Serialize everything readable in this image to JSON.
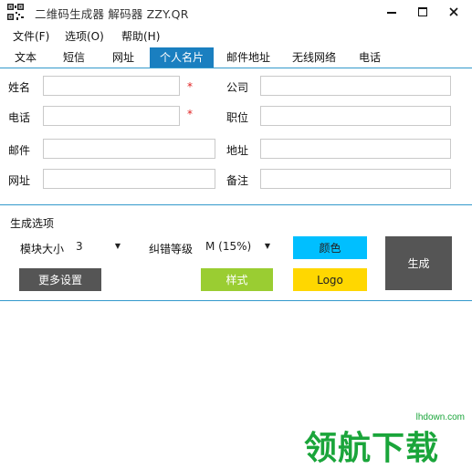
{
  "window": {
    "title": "二维码生成器 解码器 ZZY.QR",
    "minimize_icon": "minimize-icon",
    "maximize_icon": "maximize-icon",
    "close_icon": "close-icon"
  },
  "menu": [
    {
      "label": "文件(F)"
    },
    {
      "label": "选项(O)"
    },
    {
      "label": "帮助(H)"
    }
  ],
  "tabs": [
    {
      "label": "文本",
      "active": false
    },
    {
      "label": "短信",
      "active": false
    },
    {
      "label": "网址",
      "active": false
    },
    {
      "label": "个人名片",
      "active": true
    },
    {
      "label": "邮件地址",
      "active": false
    },
    {
      "label": "无线网络",
      "active": false
    },
    {
      "label": "电话",
      "active": false
    }
  ],
  "form": {
    "name_label": "姓名",
    "company_label": "公司",
    "phone_label": "电话",
    "position_label": "职位",
    "email_label": "邮件",
    "address_label": "地址",
    "website_label": "网址",
    "note_label": "备注",
    "required_mark": "*",
    "name_value": "",
    "company_value": "",
    "phone_value": "",
    "position_value": "",
    "email_value": "",
    "address_value": "",
    "website_value": "",
    "note_value": ""
  },
  "options": {
    "section_title": "生成选项",
    "module_size_label": "模块大小",
    "module_size_value": "3",
    "ecc_label": "纠错等级",
    "ecc_value": "M (15%)",
    "color_button": "颜色",
    "style_button": "样式",
    "logo_button": "Logo",
    "more_settings_button": "更多设置",
    "generate_button": "生成"
  },
  "colors": {
    "accent": "#1a7fc0",
    "color_btn": "#00bfff",
    "style_btn": "#9acd32",
    "logo_btn": "#ffd700",
    "dark_btn": "#555555",
    "watermark_green": "#1aa53a"
  },
  "watermark": {
    "site": "lhdown.com",
    "text": "领航下载"
  }
}
